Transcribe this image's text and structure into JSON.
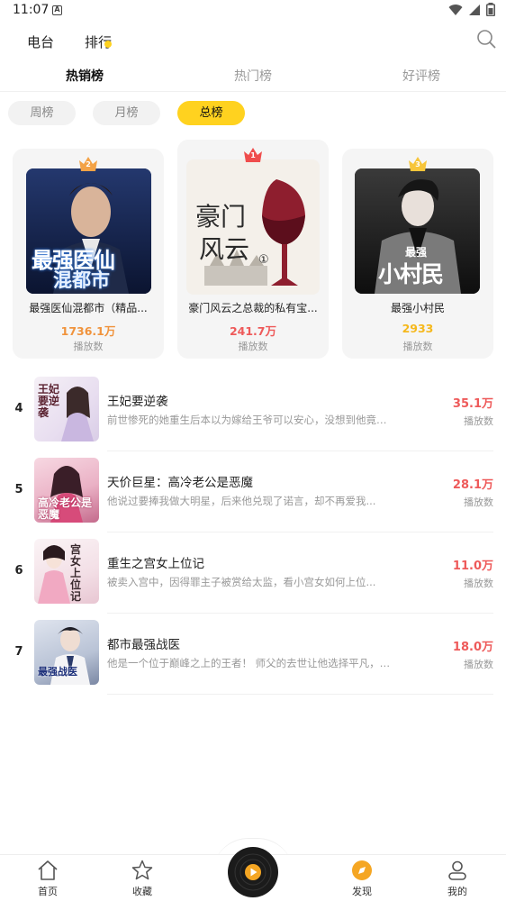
{
  "status": {
    "time": "11:07",
    "notif_letter": "A"
  },
  "top_nav": {
    "items": [
      {
        "label": "电台"
      },
      {
        "label": "排行"
      }
    ]
  },
  "tabs": [
    {
      "label": "热销榜"
    },
    {
      "label": "热门榜"
    },
    {
      "label": "好评榜"
    }
  ],
  "periods": [
    {
      "label": "周榜"
    },
    {
      "label": "月榜"
    },
    {
      "label": "总榜"
    }
  ],
  "podium": [
    {
      "rank": "2",
      "title": "最强医仙混都市（精品...",
      "count": "1736.1万",
      "plays_label": "播放数",
      "cover_text_1": "最强医仙",
      "cover_text_2": "混都市",
      "count_color": "#f0933c",
      "crown_color": "#f3a246"
    },
    {
      "rank": "1",
      "title": "豪门风云之总裁的私有宝...",
      "count": "241.7万",
      "plays_label": "播放数",
      "cover_text_1": "豪门",
      "cover_text_2": "风云",
      "cover_text_3": "①",
      "count_color": "#ee5a5a",
      "crown_color": "#ef4d4d"
    },
    {
      "rank": "3",
      "title": "最强小村民",
      "count": "2933",
      "plays_label": "播放数",
      "cover_text_1": "最强",
      "cover_text_2": "小村民",
      "count_color": "#f5b81c",
      "crown_color": "#f7c53a"
    }
  ],
  "list": [
    {
      "rank": "4",
      "title": "王妃要逆袭",
      "desc": "前世惨死的她重生后本以为嫁给王爷可以安心，没想到他竟然...",
      "count": "35.1万",
      "plays_label": "播放数",
      "cover_text": "王妃要逆袭"
    },
    {
      "rank": "5",
      "title": "天价巨星：高冷老公是恶魔",
      "desc": "他说过要捧我做大明星，后来他兑现了诺言，却不再爱我...",
      "count": "28.1万",
      "plays_label": "播放数",
      "cover_text": "高冷老公是恶魔"
    },
    {
      "rank": "6",
      "title": "重生之宫女上位记",
      "desc": "被卖入宫中，因得罪主子被赏给太监，看小宫女如何上位...",
      "count": "11.0万",
      "plays_label": "播放数",
      "cover_text": "宫女上位记"
    },
    {
      "rank": "7",
      "title": "都市最强战医",
      "desc": "他是一个位于巅峰之上的王者！ 师父的去世让他选择平凡，回到了离开十多...",
      "count": "18.0万",
      "plays_label": "播放数",
      "cover_text": "最强战医"
    }
  ],
  "bottom_nav": [
    {
      "label": "首页"
    },
    {
      "label": "收藏"
    },
    {
      "label": "发现"
    },
    {
      "label": "我的"
    }
  ],
  "colors": {
    "accent": "#ffd21f",
    "count_red": "#ee5a5a"
  }
}
